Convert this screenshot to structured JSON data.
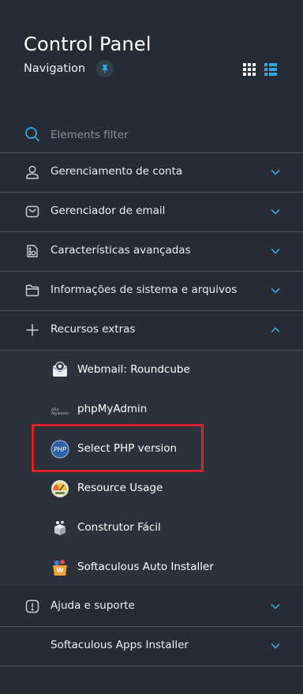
{
  "header": {
    "title": "Control Panel",
    "nav_label": "Navigation"
  },
  "filter": {
    "placeholder": "Elements filter"
  },
  "menu": [
    {
      "label": "Gerenciamento de conta",
      "icon": "user-icon",
      "expanded": false
    },
    {
      "label": "Gerenciador de email",
      "icon": "envelope-icon",
      "expanded": false
    },
    {
      "label": "Características avançadas",
      "icon": "advanced-settings-icon",
      "expanded": false
    },
    {
      "label": "Informações de sistema e arquivos",
      "icon": "folder-icon",
      "expanded": false
    },
    {
      "label": "Recursos extras",
      "icon": "plus-icon",
      "expanded": true
    },
    {
      "label": "Ajuda e suporte",
      "icon": "alert-icon",
      "expanded": false
    },
    {
      "label": "Softaculous Apps Installer",
      "icon": "",
      "expanded": false
    }
  ],
  "submenu": [
    {
      "label": "Webmail: Roundcube",
      "icon": "roundcube-icon"
    },
    {
      "label": "phpMyAdmin",
      "icon": "phpmyadmin-icon"
    },
    {
      "label": "Select PHP version",
      "icon": "php-icon",
      "highlighted": true
    },
    {
      "label": "Resource Usage",
      "icon": "resource-usage-icon"
    },
    {
      "label": "Construtor Fácil",
      "icon": "site-builder-icon"
    },
    {
      "label": "Softaculous Auto Installer",
      "icon": "softaculous-icon"
    }
  ],
  "colors": {
    "background": "#262b34",
    "submenu_background": "#2c313b",
    "accent": "#33a7de",
    "highlight_border": "#d6232b"
  }
}
